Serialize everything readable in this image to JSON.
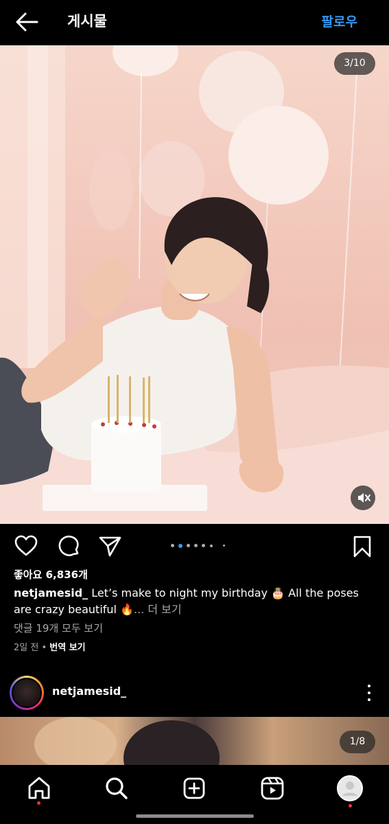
{
  "header": {
    "title": "게시물",
    "follow_label": "팔로우"
  },
  "post": {
    "media_counter": "3/10",
    "carousel": {
      "total_dots": 7,
      "active_index": 1
    },
    "likes_text": "좋아요 6,836개",
    "caption": {
      "username": "netjamesid_",
      "text": " Let’s make to night my birthday 🎂 All the poses are crazy beautiful 🔥",
      "more_label": "... 더 보기"
    },
    "comments_link": "댓글 19개 모두 보기",
    "time_ago": "2일 전",
    "separator": " • ",
    "translate_label": "번역 보기"
  },
  "next_post": {
    "username": "netjamesid_",
    "media_counter": "1/8"
  },
  "colors": {
    "accent": "#3797f0",
    "background": "#000000",
    "muted_text": "#a8a8a8",
    "notification_dot": "#ff3040"
  },
  "icons": {
    "header": [
      "back-arrow-icon"
    ],
    "actions": [
      "heart-icon",
      "comment-icon",
      "share-icon",
      "bookmark-icon"
    ],
    "media": [
      "mute-icon"
    ],
    "next_post": [
      "more-options-icon"
    ],
    "nav": [
      "home-icon",
      "search-icon",
      "create-icon",
      "reels-icon",
      "profile-icon"
    ]
  }
}
